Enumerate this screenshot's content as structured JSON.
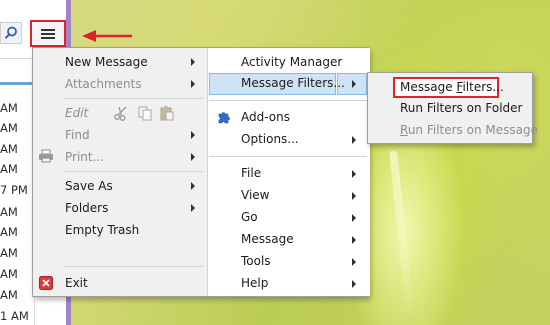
{
  "left_app": {
    "times": [
      "AM",
      "AM",
      "AM",
      "AM",
      "7 PM",
      "AM",
      "AM",
      "AM",
      "AM",
      "AM",
      "1 AM",
      "AM"
    ]
  },
  "main_menu": {
    "left": [
      {
        "label": "New Message",
        "submenu": true,
        "disabled": false
      },
      {
        "label": "Attachments",
        "submenu": true,
        "disabled": true
      },
      {
        "label": "Edit",
        "submenu": false,
        "disabled": true,
        "tools": [
          "scissors-icon",
          "copy-icon",
          "paste-icon"
        ]
      },
      {
        "label": "Find",
        "submenu": true,
        "disabled": true
      },
      {
        "label": "Print...",
        "submenu": true,
        "disabled": true,
        "icon": "printer-icon"
      },
      {
        "label": "Save As",
        "submenu": true,
        "disabled": false
      },
      {
        "label": "Folders",
        "submenu": true,
        "disabled": false
      },
      {
        "label": "Empty Trash",
        "submenu": false,
        "disabled": false
      },
      {
        "label": "Exit",
        "submenu": false,
        "disabled": false,
        "icon": "exit-icon"
      }
    ],
    "right": [
      {
        "label": "Activity Manager",
        "submenu": false
      },
      {
        "label": "Message Filters...",
        "submenu": true,
        "highlighted": true
      },
      {
        "label": "Add-ons",
        "submenu": false,
        "icon": "puzzle-icon"
      },
      {
        "label": "Options...",
        "submenu": true
      },
      {
        "label": "File",
        "submenu": true
      },
      {
        "label": "View",
        "submenu": true
      },
      {
        "label": "Go",
        "submenu": true
      },
      {
        "label": "Message",
        "submenu": true
      },
      {
        "label": "Tools",
        "submenu": true
      },
      {
        "label": "Help",
        "submenu": true
      }
    ]
  },
  "filters_submenu": {
    "items": [
      {
        "label": "Message Filters...",
        "mnemonic": "F",
        "highlighted": true,
        "disabled": false
      },
      {
        "label": "Run Filters on Folder",
        "disabled": false
      },
      {
        "label": "Run Filters on Message",
        "mnemonic": "R",
        "disabled": true
      }
    ]
  },
  "colors": {
    "annotation_red": "#d9262c",
    "highlight_blue": "#cfe3f7",
    "highlight_border": "#8db9e6",
    "accent_purple": "#a383c9"
  }
}
